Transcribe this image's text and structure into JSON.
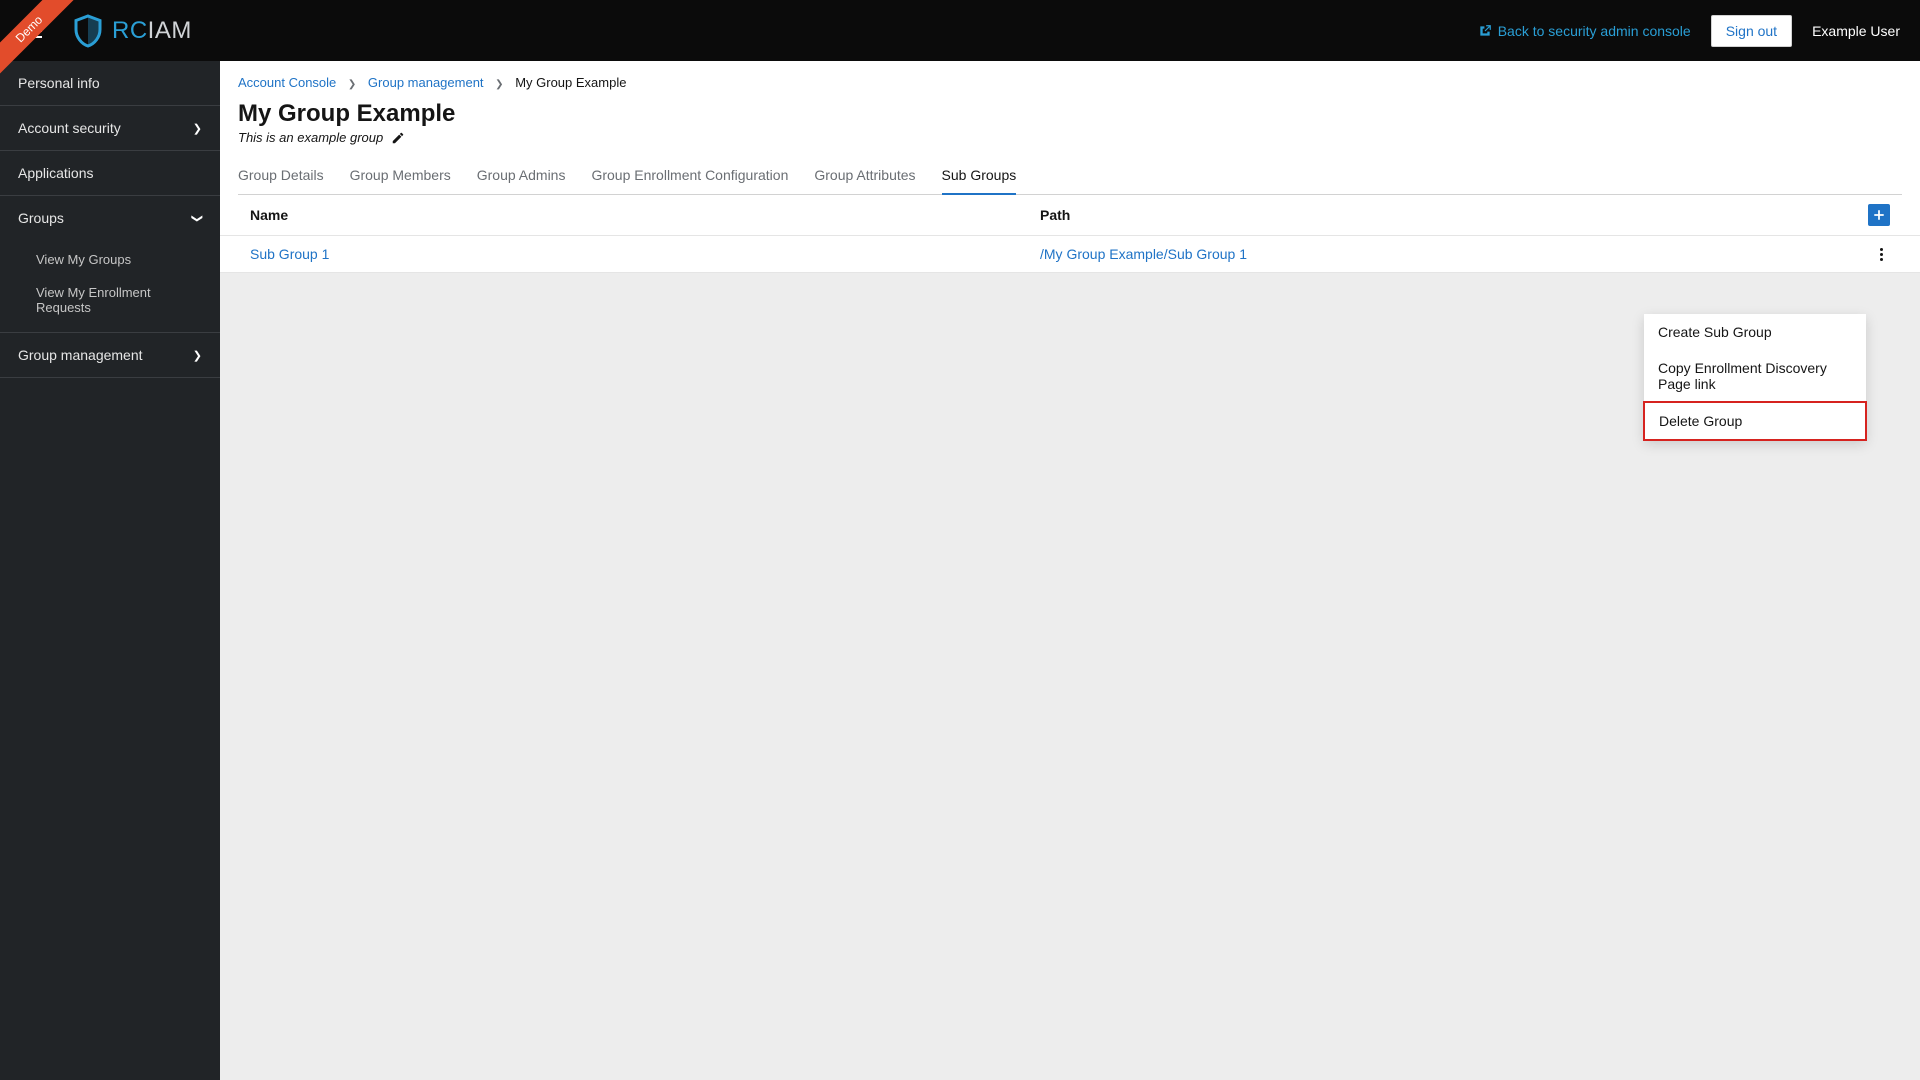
{
  "ribbon": "Demo",
  "logo": {
    "rc": "RC",
    "iam": "IAM"
  },
  "header": {
    "back_link": "Back to security admin console",
    "signout": "Sign out",
    "user": "Example User"
  },
  "sidebar": {
    "personal_info": "Personal info",
    "account_security": "Account security",
    "applications": "Applications",
    "groups": "Groups",
    "view_my_groups": "View My Groups",
    "view_enrollment": "View My Enrollment Requests",
    "group_management": "Group management"
  },
  "breadcrumb": {
    "account_console": "Account Console",
    "group_management": "Group management",
    "current": "My Group Example"
  },
  "page": {
    "title": "My Group Example",
    "desc": "This is an example group"
  },
  "tabs": {
    "details": "Group Details",
    "members": "Group Members",
    "admins": "Group Admins",
    "enrollment": "Group Enrollment Configuration",
    "attributes": "Group Attributes",
    "subgroups": "Sub Groups"
  },
  "table": {
    "col_name": "Name",
    "col_path": "Path",
    "row1_name": "Sub Group 1",
    "row1_path": "/My Group Example/Sub Group 1"
  },
  "menu": {
    "create": "Create Sub Group",
    "copy": "Copy Enrollment Discovery Page link",
    "delete": "Delete Group"
  }
}
